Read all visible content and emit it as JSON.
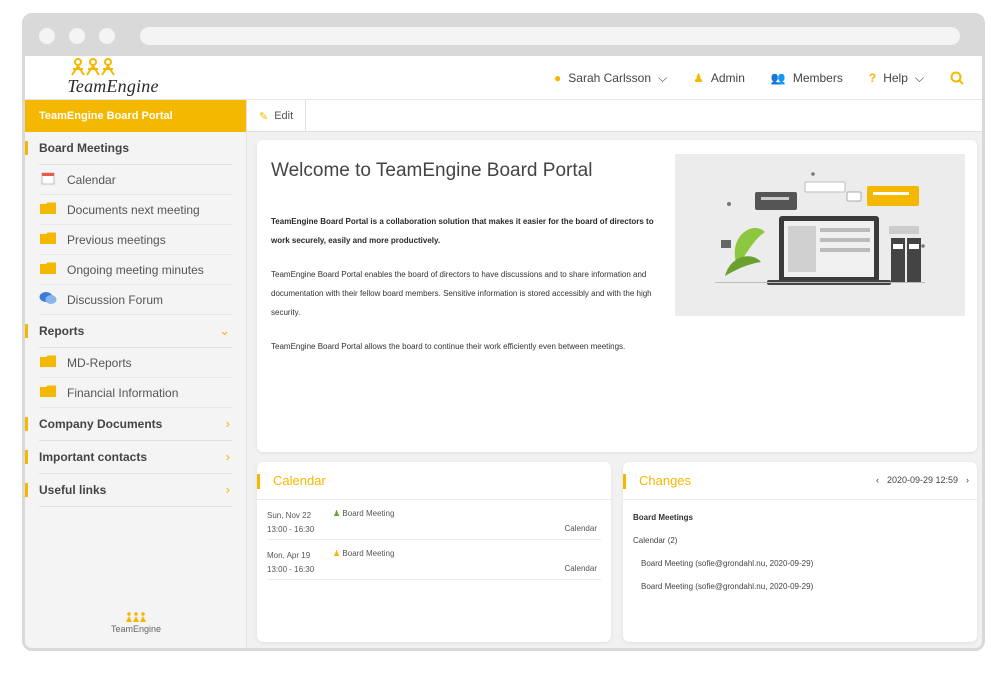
{
  "topbar": {
    "logo_text": "TeamEngine",
    "user": "Sarah Carlsson",
    "admin": "Admin",
    "members": "Members",
    "help": "Help"
  },
  "sidebar": {
    "portal_title": "TeamEngine Board Portal",
    "sections": {
      "board_meetings": "Board Meetings",
      "reports": "Reports",
      "company_documents": "Company Documents",
      "important_contacts": "Important contacts",
      "useful_links": "Useful links"
    },
    "items": {
      "calendar": "Calendar",
      "documents_next": "Documents next meeting",
      "previous": "Previous meetings",
      "ongoing": "Ongoing meeting minutes",
      "forum": "Discussion Forum",
      "md_reports": "MD-Reports",
      "financial": "Financial Information"
    },
    "footer": "TeamEngine"
  },
  "main": {
    "edit_label": "Edit",
    "welcome_title": "Welcome to TeamEngine Board Portal",
    "para1": "TeamEngine Board Portal is a collaboration solution that makes it easier for the board of directors to work securely, easily and more productively.",
    "para2": "TeamEngine Board Portal enables the board of directors to have discussions and to share information and documentation with their fellow board members. Sensitive information is stored accessibly and with the high security.",
    "para3": "TeamEngine Board Portal allows the board to continue their work efficiently even between meetings."
  },
  "calendar": {
    "title": "Calendar",
    "events": [
      {
        "date": "Sun, Nov 22",
        "time": "13:00 - 16:30",
        "title": "Board Meeting",
        "link": "Calendar"
      },
      {
        "date": "Mon, Apr 19",
        "time": "13:00 - 16:30",
        "title": "Board Meeting",
        "link": "Calendar"
      }
    ]
  },
  "changes": {
    "title": "Changes",
    "date": "2020-09-29 12:59",
    "section": "Board Meetings",
    "sub": "Calendar (2)",
    "entries": [
      "Board Meeting (sofie@grondahl.nu, 2020-09-29)",
      "Board Meeting (sofie@grondahl.nu, 2020-09-29)"
    ]
  },
  "colors": {
    "accent": "#f5b800",
    "sidebar_bg": "#f4f4f4",
    "chrome": "#d9d9d9"
  }
}
